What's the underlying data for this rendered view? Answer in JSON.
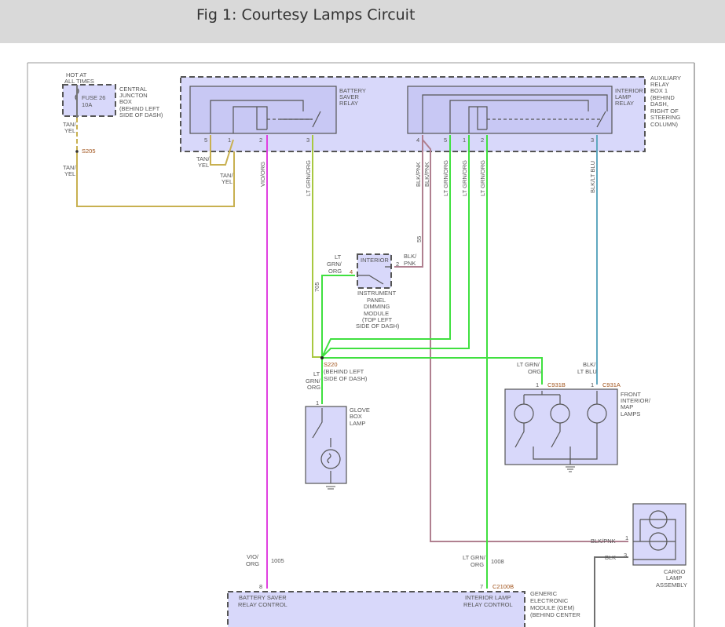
{
  "header": {
    "title": "Fig 1: Courtesy Lamps Circuit"
  },
  "colors": {
    "tan_yel": "#c8b050",
    "vio_org": "#e040e0",
    "lt_grn_org": "#40e040",
    "blk_pnk": "#b08090",
    "blk_lt_blu": "#60a8c0",
    "blk": "#707070"
  },
  "hot": [
    "HOT AT",
    "ALL TIMES"
  ],
  "cjb": {
    "fuse": [
      "FUSE 26",
      "10A"
    ],
    "label": [
      "CENTRAL",
      "JUNCTON",
      "BOX",
      "(BEHIND LEFT",
      "SIDE OF DASH)"
    ]
  },
  "splice_s205": "S205",
  "wire_tan_yel": [
    "TAN/",
    "YEL"
  ],
  "bsr": {
    "label": [
      "BATTERY",
      "SAVER",
      "RELAY"
    ],
    "pins": [
      "5",
      "1",
      "2",
      "3"
    ]
  },
  "ilr": {
    "label": [
      "INTERIOR",
      "LAMP",
      "RELAY"
    ],
    "pins": [
      "4",
      "5",
      "1",
      "2",
      "3"
    ]
  },
  "aux": [
    "AUXILIARY",
    "RELAY",
    "BOX 1",
    "(BEHIND",
    "DASH,",
    "RIGHT OF",
    "STEERING",
    "COLUMN)"
  ],
  "vert_labels": {
    "vio_org": "VIO/ORG",
    "lt_grn_org": "LT GRN/ORG",
    "blk_pnk": "BLK/PNK",
    "blk_lt_blu": "BLK/LT BLU",
    "c55": "55",
    "c705": "705"
  },
  "ipdm": {
    "inner": "INTERIOR",
    "pin4": "4",
    "pin2": "2",
    "label": [
      "INSTRUMENT",
      "PANEL",
      "DIMMING",
      "MODULE",
      "(TOP LEFT",
      "SIDE OF DASH)"
    ],
    "wire_left": [
      "LT",
      "GRN/",
      "ORG"
    ],
    "wire_right": [
      "BLK/",
      "PNK"
    ]
  },
  "s220": {
    "name": "S220",
    "loc": [
      "(BEHIND LEFT",
      "SIDE OF DASH)"
    ],
    "wire": [
      "LT",
      "GRN/",
      "ORG"
    ]
  },
  "glove": {
    "pin": "1",
    "label": [
      "GLOVE",
      "BOX",
      "LAMP"
    ]
  },
  "front": {
    "wire_b": [
      "LT GRN/",
      "ORG"
    ],
    "wire_a": [
      "BLK/",
      "LT BLU"
    ],
    "pin_b": "1",
    "conn_b": "C931B",
    "pin_a": "1",
    "conn_a": "C931A",
    "label": [
      "FRONT",
      "INTERIOR/",
      "MAP",
      "LAMPS"
    ]
  },
  "cargo": {
    "wire1": "BLK/PNK",
    "pin1": "1",
    "wire3": "BLK",
    "pin3": "3",
    "label": [
      "CARGO",
      "LAMP",
      "ASSEMBLY"
    ]
  },
  "gem": {
    "wire8": [
      "VIO/",
      "ORG"
    ],
    "circ8": "1005",
    "pin8": "8",
    "wire7": [
      "LT GRN/",
      "ORG"
    ],
    "circ7": "1008",
    "pin7": "7",
    "conn": "C2100B",
    "left": [
      "BATTERY SAVER",
      "RELAY CONTROL"
    ],
    "right": [
      "INTERIOR LAMP",
      "RELAY CONTROL"
    ],
    "label": [
      "GENERIC",
      "ELECTRONIC",
      "MODULE (GEM)",
      "(BEHIND CENTER"
    ]
  }
}
